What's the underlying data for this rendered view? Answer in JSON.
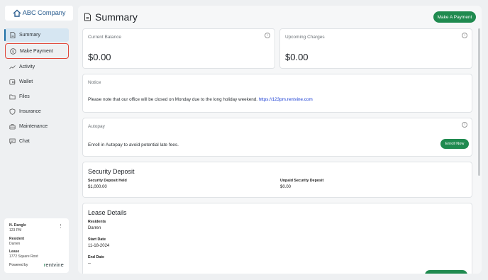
{
  "brand": {
    "logo_text": "ABC Company",
    "accent": "#1f8a4f",
    "nav_active_bg": "#d6e6f2",
    "highlight": "#e0483a"
  },
  "sidebar": {
    "items": [
      {
        "label": "Summary",
        "icon": "document-icon"
      },
      {
        "label": "Make Payment",
        "icon": "dollar-circle-icon"
      },
      {
        "label": "Activity",
        "icon": "trend-line-icon"
      },
      {
        "label": "Wallet",
        "icon": "wallet-icon"
      },
      {
        "label": "Files",
        "icon": "folder-icon"
      },
      {
        "label": "Insurance",
        "icon": "shield-icon"
      },
      {
        "label": "Maintenance",
        "icon": "toolbox-icon"
      },
      {
        "label": "Chat",
        "icon": "chat-icon"
      }
    ],
    "user": {
      "name": "N. Dangle",
      "unit": "123 PM",
      "resident_label": "Resident",
      "resident_value": "Darren",
      "lease_label": "Lease",
      "lease_value": "1772 Square Root",
      "powered_by": "Powered by",
      "powered_brand_prefix": "r",
      "powered_brand_rest": "entvine"
    }
  },
  "main": {
    "title": "Summary",
    "make_payment_button": "Make A Payment",
    "current_balance": {
      "label": "Current Balance",
      "value": "$0.00"
    },
    "upcoming_charges": {
      "label": "Upcoming Charges",
      "value": "$0.00"
    },
    "notice": {
      "label": "Notice",
      "text": "Please note that our office will be closed on Monday due to the long holiday weekend.",
      "link": "https://123pm.rentvine.com"
    },
    "autopay": {
      "label": "Autopay",
      "text": "Enroll in Autopay to avoid potential late fees.",
      "button": "Enroll Now"
    },
    "security_deposit": {
      "title": "Security Deposit",
      "held_label": "Security Deposit Held",
      "held_value": "$1,000.00",
      "unpaid_label": "Unpaid Security Deposit",
      "unpaid_value": "$0.00"
    },
    "lease_details": {
      "title": "Lease Details",
      "residents_label": "Residents",
      "residents_value": "Darren",
      "start_label": "Start Date",
      "start_value": "11-18-2024",
      "end_label": "End Date",
      "end_value": "--"
    }
  }
}
